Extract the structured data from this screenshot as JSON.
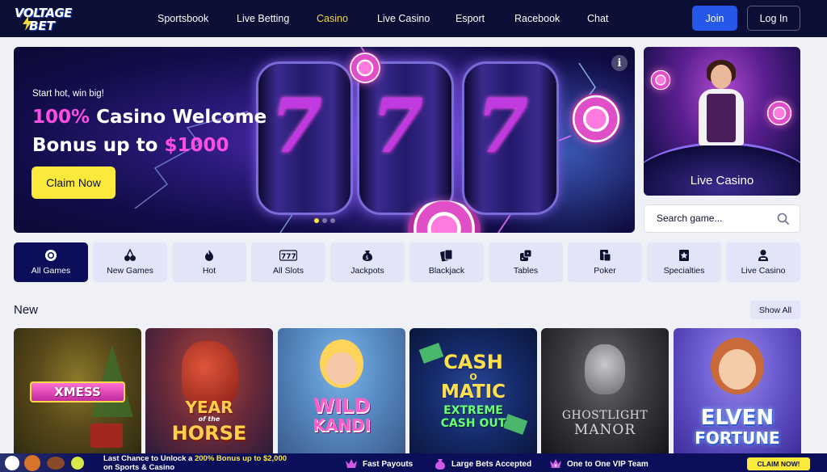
{
  "brand": {
    "logo_line1": "VOLTAGE",
    "logo_line2": "BET"
  },
  "nav": {
    "items": [
      {
        "label": "Sportsbook"
      },
      {
        "label": "Live Betting"
      },
      {
        "label": "Casino"
      },
      {
        "label": "Live Casino"
      },
      {
        "label": "Esport"
      },
      {
        "label": "Racebook"
      },
      {
        "label": "Chat"
      }
    ],
    "active": "Casino",
    "join_label": "Join",
    "login_label": "Log In"
  },
  "hero": {
    "eyebrow": "Start hot, win big!",
    "headline_percent": "100%",
    "headline_rest": " Casino Welcome",
    "headline_line2": "Bonus up to ",
    "headline_amount": "$1000",
    "cta_label": "Claim Now",
    "info_icon": "info-icon",
    "slides": 3,
    "active_slide": 1
  },
  "live_casino_card": {
    "label": "Live Casino"
  },
  "search": {
    "placeholder": "Search game..."
  },
  "categories": [
    {
      "label": "All Games",
      "icon": "chip-icon",
      "active": true
    },
    {
      "label": "New Games",
      "icon": "cherries-icon"
    },
    {
      "label": "Hot",
      "icon": "flame-icon"
    },
    {
      "label": "All Slots",
      "icon": "slots-777-icon"
    },
    {
      "label": "Jackpots",
      "icon": "money-bag-icon"
    },
    {
      "label": "Blackjack",
      "icon": "cards-icon"
    },
    {
      "label": "Tables",
      "icon": "dice-icon"
    },
    {
      "label": "Poker",
      "icon": "poker-cards-icon"
    },
    {
      "label": "Specialties",
      "icon": "star-card-icon"
    },
    {
      "label": "Live Casino",
      "icon": "dealer-icon"
    }
  ],
  "new_section": {
    "title": "New",
    "show_all_label": "Show All",
    "games": [
      {
        "title": "XMESS"
      },
      {
        "title_top": "YEAR",
        "title_mid": "of the",
        "title_bottom": "HORSE"
      },
      {
        "title_top": "WILD",
        "title_bottom": "KANDI"
      },
      {
        "title_top": "CASH",
        "title_mid": "O",
        "title_bottom": "MATIC",
        "subtitle1": "EXTREME",
        "subtitle2": "CASH OUT"
      },
      {
        "title_top": "GHOSTLIGHT",
        "title_bottom": "MANOR"
      },
      {
        "title_top": "ELVEN",
        "title_bottom": "FORTUNE"
      }
    ]
  },
  "promo_bar": {
    "line1_pre": "Last Chance to Unlock a ",
    "line1_highlight": "200% Bonus up to $2,000",
    "line2": "on Sports & Casino",
    "features": [
      {
        "label": "Fast Payouts",
        "icon": "crown-icon"
      },
      {
        "label": "Large Bets Accepted",
        "icon": "money-bag-icon"
      },
      {
        "label": "One to One VIP Team",
        "icon": "vip-crown-icon"
      }
    ],
    "cta_label": "CLAIM NOW!"
  },
  "colors": {
    "nav_bg": "#0b0e35",
    "accent_blue": "#2557e8",
    "accent_yellow": "#fbe93c",
    "headline_pink": "#ff4de3",
    "tab_bg": "#e2e5f7",
    "tab_active_bg": "#0b0e58"
  }
}
